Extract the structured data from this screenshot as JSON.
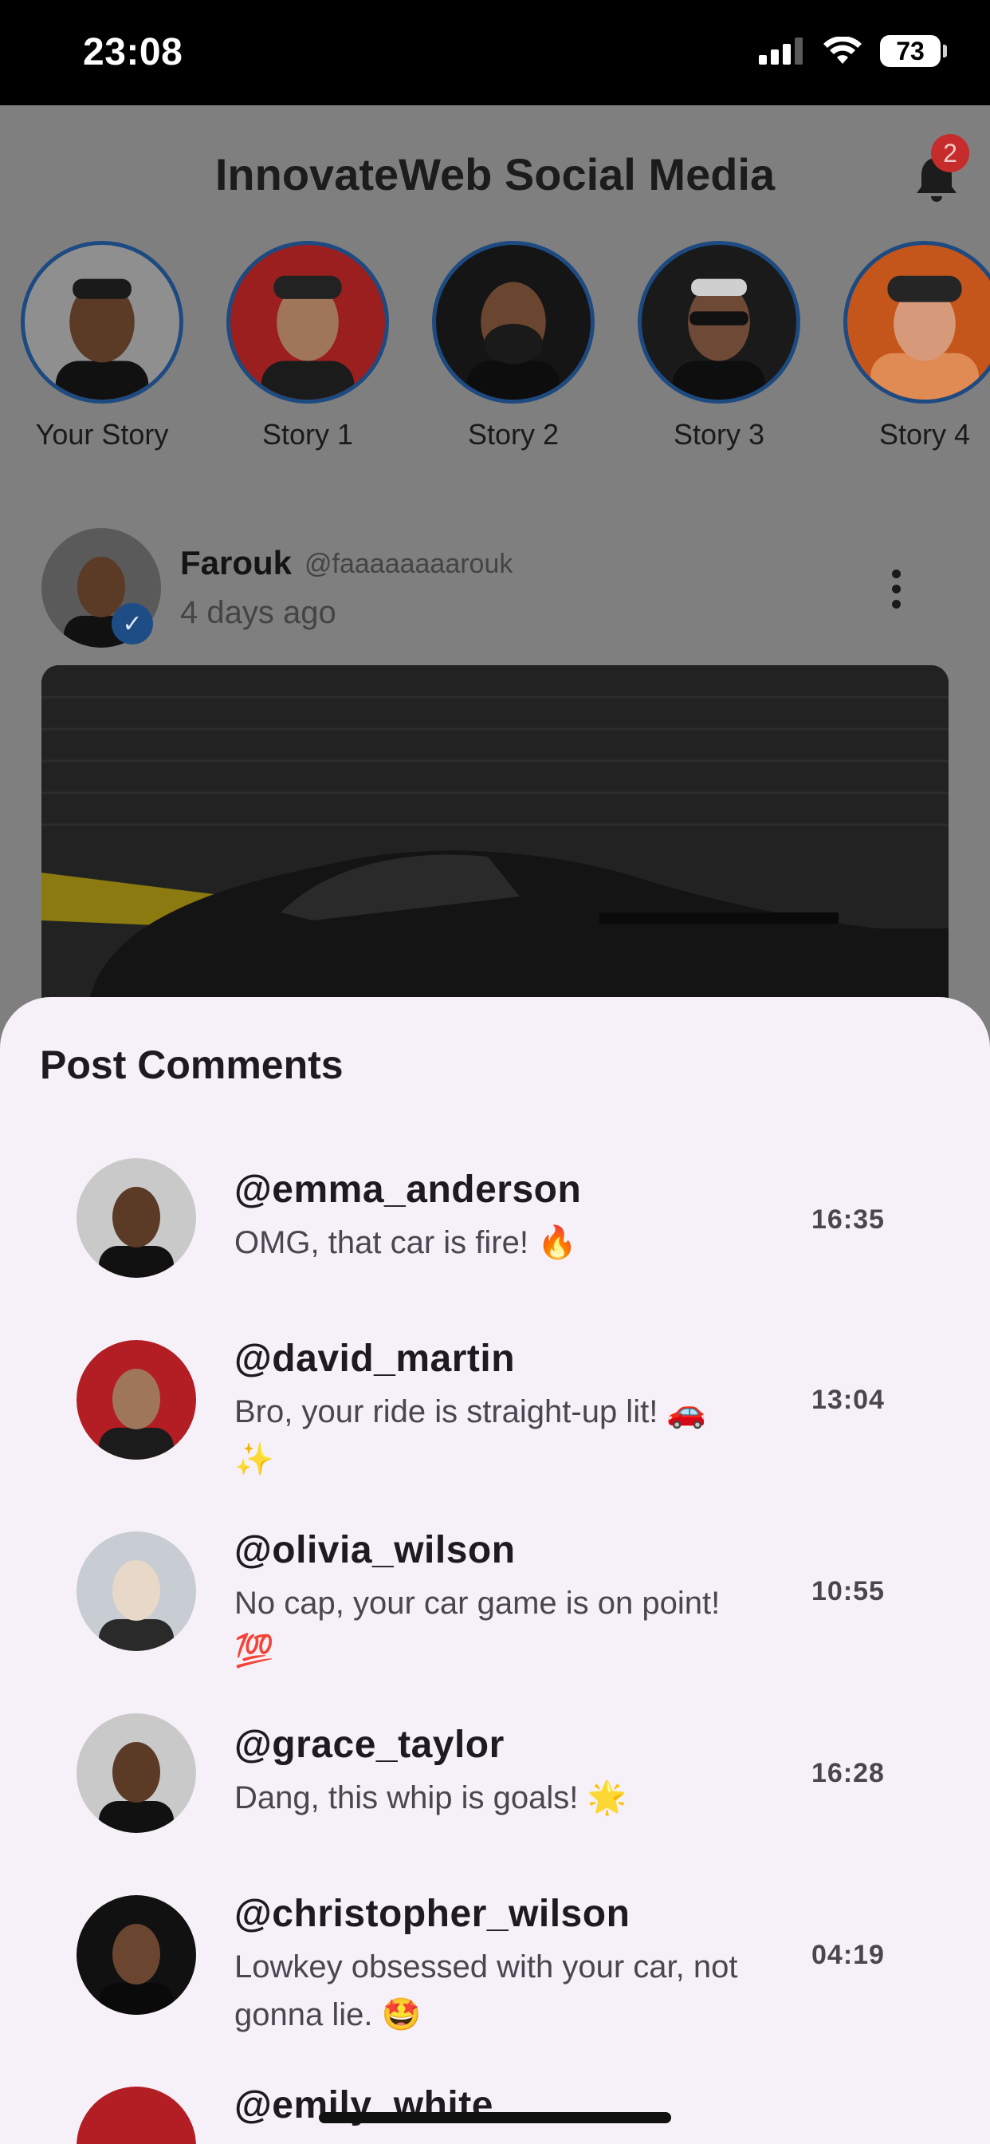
{
  "status_bar": {
    "time": "23:08",
    "battery": "73"
  },
  "header": {
    "title": "InnovateWeb Social Media",
    "notification_count": "2"
  },
  "stories": [
    {
      "label": "Your Story",
      "bg": "#8f8f8f"
    },
    {
      "label": "Story 1",
      "bg": "#9c1f1f"
    },
    {
      "label": "Story 2",
      "bg": "#151515"
    },
    {
      "label": "Story 3",
      "bg": "#1a1a1a"
    },
    {
      "label": "Story 4",
      "bg": "#c4561c"
    }
  ],
  "post": {
    "name": "Farouk",
    "handle": "@faaaaaaaarouk",
    "time": "4 days ago"
  },
  "comments_sheet": {
    "title": "Post Comments",
    "comments": [
      {
        "user": "@emma_anderson",
        "text": "OMG, that car is fire! 🔥",
        "time": "16:35",
        "avatar_bg": "#c9c9c9"
      },
      {
        "user": "@david_martin",
        "text": "Bro, your ride is straight-up lit! 🚗✨",
        "time": "13:04",
        "avatar_bg": "#b31e24"
      },
      {
        "user": "@olivia_wilson",
        "text": "No cap, your car game is on point! 💯",
        "time": "10:55",
        "avatar_bg": "#c8ccd3"
      },
      {
        "user": "@grace_taylor",
        "text": "Dang, this whip is goals! 🌟",
        "time": "16:28",
        "avatar_bg": "#c9c9c9"
      },
      {
        "user": "@christopher_wilson",
        "text": "Lowkey obsessed with your car, not gonna lie. 🤩",
        "time": "04:19",
        "avatar_bg": "#111111"
      },
      {
        "user": "@emily_white",
        "text": "",
        "time": "",
        "avatar_bg": "#b31e24"
      }
    ]
  }
}
